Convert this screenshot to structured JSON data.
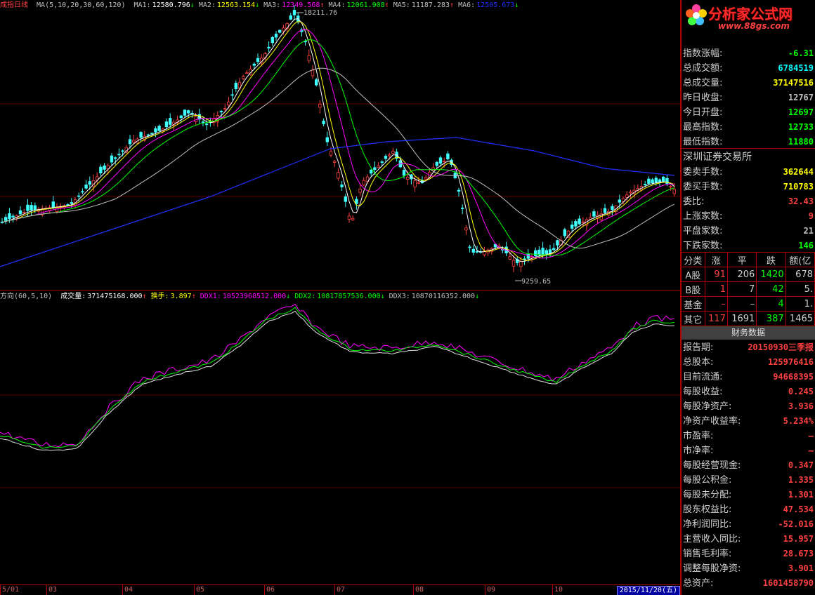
{
  "header": {
    "index_name": "成指",
    "period": "日线",
    "ma_spec": "MA(5,10,20,30,60,120)",
    "ma_items": [
      {
        "label": "MA1:",
        "value": "12580.796",
        "arrow": "↓",
        "color": "#ffffff"
      },
      {
        "label": "MA2:",
        "value": "12563.154",
        "arrow": "↓",
        "color": "#ffff00"
      },
      {
        "label": "MA3:",
        "value": "12349.568",
        "arrow": "↑",
        "color": "#ff00ff"
      },
      {
        "label": "MA4:",
        "value": "12061.908",
        "arrow": "↑",
        "color": "#00ff00"
      },
      {
        "label": "MA5:",
        "value": "11187.283",
        "arrow": "↑",
        "color": "#c0c0c0"
      },
      {
        "label": "MA6:",
        "value": "12505.673",
        "arrow": "↓",
        "color": "#2030ff"
      }
    ]
  },
  "indicator_header": {
    "name": "方向(60,5,10)",
    "items": [
      {
        "label": "成交量:",
        "value": "371475168.000",
        "arrow": "↑",
        "color": "#ffffff"
      },
      {
        "label": "换手:",
        "value": "3.897",
        "arrow": "↑",
        "color": "#ffff00"
      },
      {
        "label": "DDX1:",
        "value": "10523968512.000",
        "arrow": "↓",
        "color": "#ff00ff"
      },
      {
        "label": "DDX2:",
        "value": "10817857536.000",
        "arrow": "↓",
        "color": "#00ff00"
      },
      {
        "label": "DDX3:",
        "value": "10870116352.000",
        "arrow": "↓",
        "color": "#c0c0c0"
      }
    ]
  },
  "annotations": {
    "high": "18211.76",
    "low": "9259.65"
  },
  "x_axis": {
    "labels": [
      "5/01",
      "03",
      "04",
      "05",
      "06",
      "07",
      "08",
      "09",
      "10"
    ],
    "cursor_date": "2015/11/20(五)"
  },
  "logo": {
    "text": "分析家公式网",
    "url": "www.88gs.com"
  },
  "index_stats": [
    {
      "label": "指数涨幅:",
      "value": "-6.31",
      "color": "#00ff00"
    },
    {
      "label": "总成交额:",
      "value": "6784519",
      "color": "#00ffff"
    },
    {
      "label": "总成交量:",
      "value": "37147516",
      "color": "#ffff00"
    },
    {
      "label": "昨日收盘:",
      "value": "12767",
      "color": "#c0c0c0"
    },
    {
      "label": "今日开盘:",
      "value": "12697",
      "color": "#00ff00"
    },
    {
      "label": "最高指数:",
      "value": "12733",
      "color": "#00ff00"
    },
    {
      "label": "最低指数:",
      "value": "11880",
      "color": "#00ff00"
    }
  ],
  "exchange": {
    "title": "深圳证券交易所",
    "rows": [
      {
        "label": "委卖手数:",
        "value": "362644",
        "color": "#ffff00"
      },
      {
        "label": "委买手数:",
        "value": "710783",
        "color": "#ffff00"
      },
      {
        "label": "委比:",
        "value": "32.43",
        "color": "#ff4040"
      },
      {
        "label": "上涨家数:",
        "value": "9",
        "color": "#ff4040"
      },
      {
        "label": "平盘家数:",
        "value": "21",
        "color": "#c0c0c0"
      },
      {
        "label": "下跌家数:",
        "value": "146",
        "color": "#00ff00"
      }
    ]
  },
  "breadth": {
    "headers": [
      "分类",
      "涨",
      "平",
      "跌",
      "额(亿"
    ],
    "rows": [
      {
        "name": "A股",
        "up": "91",
        "flat": "206",
        "down": "1420",
        "amt": "678"
      },
      {
        "name": "B股",
        "up": "1",
        "flat": "7",
        "down": "42",
        "amt": "5."
      },
      {
        "name": "基金",
        "up": "–",
        "flat": "–",
        "down": "4",
        "amt": "1."
      },
      {
        "name": "其它",
        "up": "117",
        "flat": "1691",
        "down": "387",
        "amt": "1465"
      }
    ]
  },
  "financial": {
    "title": "财务数据",
    "rows": [
      {
        "label": "报告期:",
        "value": "20150930三季报",
        "color": "#ff4040"
      },
      {
        "label": "总股本:",
        "value": "125976416",
        "color": "#ff4040"
      },
      {
        "label": "目前流通:",
        "value": "94668395",
        "color": "#ff4040"
      },
      {
        "label": "每股收益:",
        "value": "0.245",
        "color": "#ff4040"
      },
      {
        "label": "每股净资产:",
        "value": "3.936",
        "color": "#ff4040"
      },
      {
        "label": "净资产收益率:",
        "value": "5.234%",
        "color": "#ff4040"
      },
      {
        "label": "市盈率:",
        "value": "–",
        "color": "#ff4040"
      },
      {
        "label": "市净率:",
        "value": "–",
        "color": "#ff4040"
      },
      {
        "label": "每股经营现金:",
        "value": "0.347",
        "color": "#ff4040"
      },
      {
        "label": "每股公积金:",
        "value": "1.335",
        "color": "#ff4040"
      },
      {
        "label": "每股未分配:",
        "value": "1.301",
        "color": "#ff4040"
      },
      {
        "label": "股东权益比:",
        "value": "47.534",
        "color": "#ff4040"
      },
      {
        "label": "净利润同比:",
        "value": "-52.016",
        "color": "#ff4040"
      },
      {
        "label": "主营收入同比:",
        "value": "15.957",
        "color": "#ff4040"
      },
      {
        "label": "销售毛利率:",
        "value": "28.673",
        "color": "#ff4040"
      },
      {
        "label": "调整每股净资:",
        "value": "3.901",
        "color": "#ff4040"
      },
      {
        "label": "总资产:",
        "value": "1601458790",
        "color": "#ff4040"
      }
    ]
  }
}
